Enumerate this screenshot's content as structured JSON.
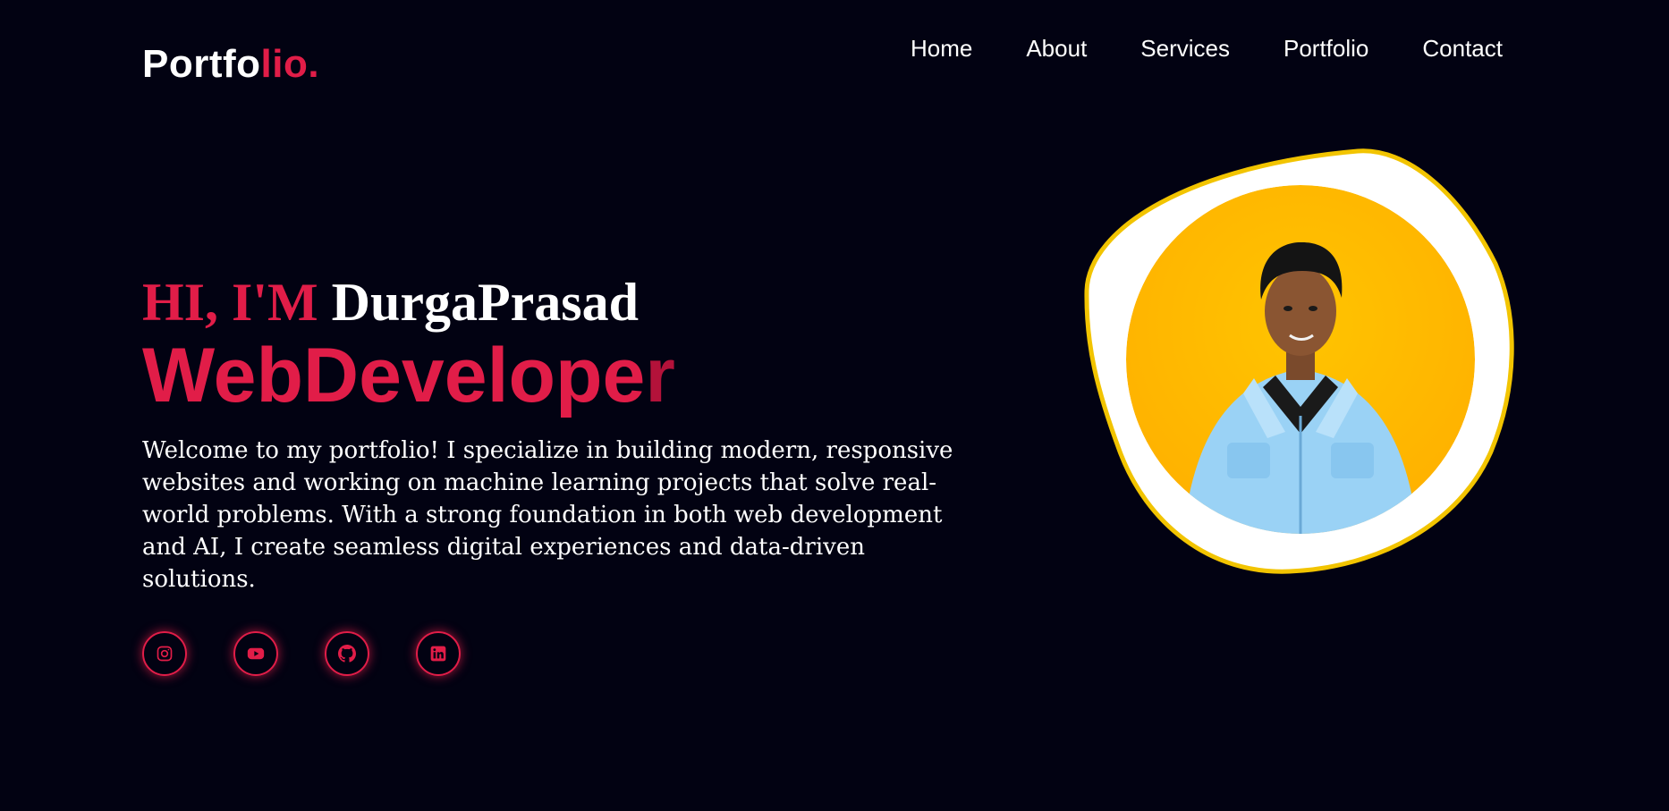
{
  "logo": {
    "main": "Portfo",
    "accent": "lio."
  },
  "nav": {
    "items": [
      {
        "label": "Home"
      },
      {
        "label": "About"
      },
      {
        "label": "Services"
      },
      {
        "label": "Portfolio"
      },
      {
        "label": "Contact"
      }
    ]
  },
  "hero": {
    "greeting": "HI, I'M",
    "name": "DurgaPrasad",
    "role": "WebDevelope",
    "role_tail": "r",
    "intro": "Welcome to my portfolio! I specialize in building modern, responsive websites and working on machine learning projects that solve real-world problems. With a strong foundation in both web development and AI, I create seamless digital experiences and data-driven solutions."
  },
  "socials": [
    {
      "icon": "instagram-icon"
    },
    {
      "icon": "youtube-icon"
    },
    {
      "icon": "github-icon"
    },
    {
      "icon": "linkedin-icon"
    }
  ],
  "colors": {
    "background": "#020212",
    "accent": "#e11d48",
    "photo_border": "#f2c400",
    "photo_background": "#ffbd00"
  }
}
